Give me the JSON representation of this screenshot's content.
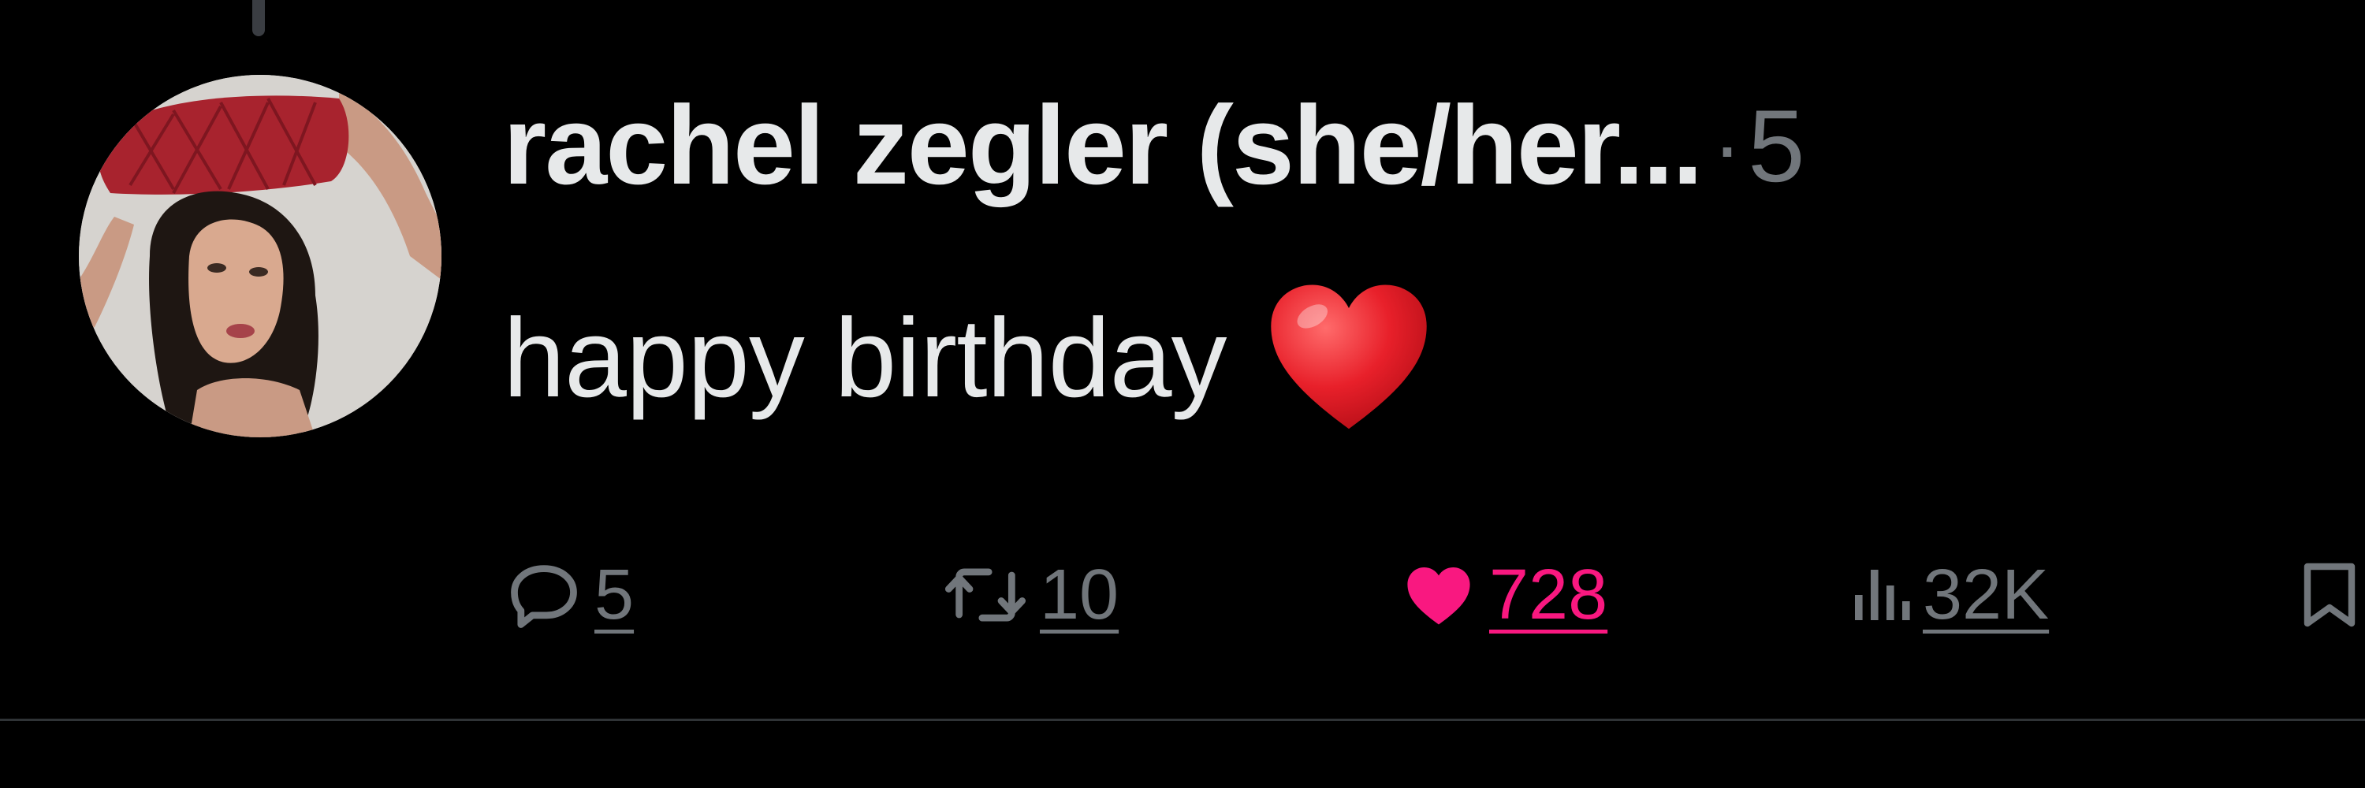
{
  "tweet": {
    "display_name": "rachel zegler (she/her...",
    "separator": "·",
    "timestamp": "5",
    "text": "happy birthday",
    "emoji": "red-heart-emoji"
  },
  "actions": {
    "reply_count": "5",
    "retweet_count": "10",
    "like_count": "728",
    "views_count": "32K"
  },
  "colors": {
    "background": "#000000",
    "primary_text": "#e7e9ea",
    "secondary_text": "#71767b",
    "like_active": "#f91880",
    "divider": "#2f3336"
  },
  "icons": {
    "reply": "reply-icon",
    "retweet": "retweet-icon",
    "like": "like-icon",
    "views": "views-icon",
    "bookmark": "bookmark-icon"
  }
}
